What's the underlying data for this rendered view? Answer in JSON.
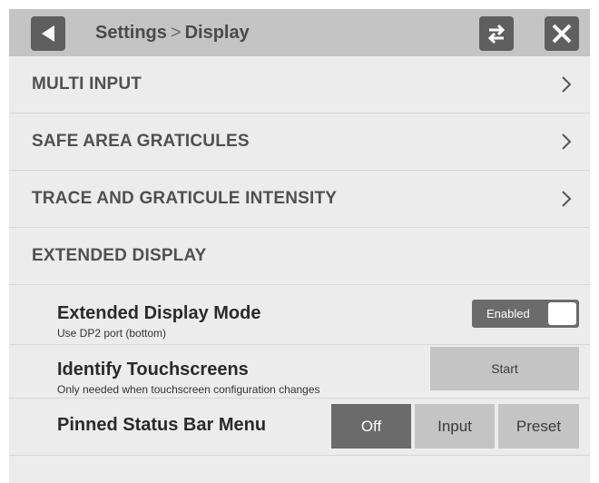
{
  "header": {
    "breadcrumb_parent": "Settings",
    "breadcrumb_separator": ">",
    "breadcrumb_current": "Display"
  },
  "menu": {
    "items": [
      {
        "label": "MULTI INPUT"
      },
      {
        "label": "SAFE AREA GRATICULES"
      },
      {
        "label": "TRACE AND GRATICULE INTENSITY"
      }
    ],
    "section_label": "EXTENDED DISPLAY"
  },
  "extended_display_mode": {
    "title": "Extended Display Mode",
    "description": "Use DP2 port (bottom)",
    "toggle_label": "Enabled",
    "enabled": true
  },
  "identify_touchscreens": {
    "title": "Identify Touchscreens",
    "description": "Only needed when touchscreen configuration changes",
    "button_label": "Start"
  },
  "pinned_status_bar": {
    "title": "Pinned Status Bar Menu",
    "options": [
      "Off",
      "Input",
      "Preset"
    ],
    "selected": "Off"
  },
  "colors": {
    "header_bg": "#c4c4c4",
    "panel_bg": "#ececec",
    "active_control": "#6b6b6b",
    "inactive_control": "#c4c4c4"
  }
}
